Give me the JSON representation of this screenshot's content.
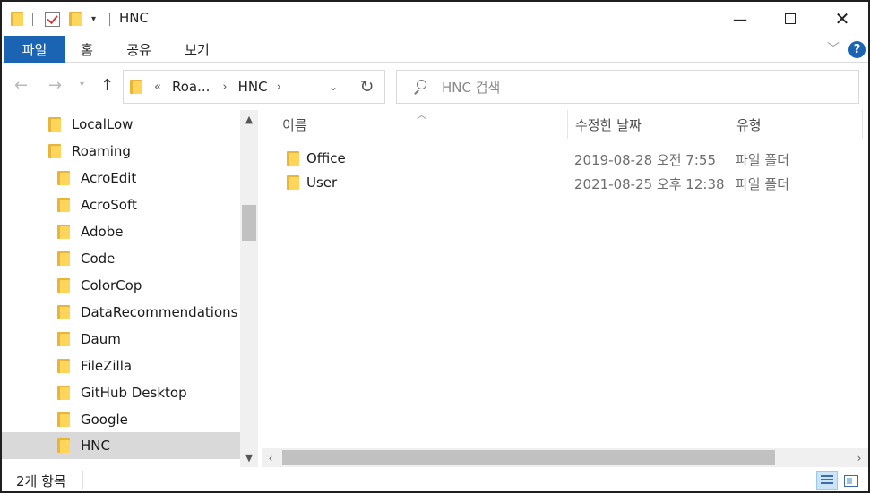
{
  "window": {
    "title": "HNC"
  },
  "ribbon": {
    "tabs": [
      {
        "label": "파일"
      },
      {
        "label": "홈"
      },
      {
        "label": "공유"
      },
      {
        "label": "보기"
      }
    ]
  },
  "address": {
    "overflow": "«",
    "crumb1": "Roa...",
    "crumb2": "HNC"
  },
  "search": {
    "placeholder": "HNC 검색"
  },
  "navpane": {
    "items": [
      {
        "label": "LocalLow"
      },
      {
        "label": "Roaming"
      },
      {
        "label": "AcroEdit"
      },
      {
        "label": "AcroSoft"
      },
      {
        "label": "Adobe"
      },
      {
        "label": "Code"
      },
      {
        "label": "ColorCop"
      },
      {
        "label": "DataRecommendations"
      },
      {
        "label": "Daum"
      },
      {
        "label": "FileZilla"
      },
      {
        "label": "GitHub Desktop"
      },
      {
        "label": "Google"
      },
      {
        "label": "HNC"
      }
    ],
    "selected": "HNC"
  },
  "filelist": {
    "columns": {
      "name": "이름",
      "date": "수정한 날짜",
      "type": "유형"
    },
    "rows": [
      {
        "name": "Office",
        "date": "2019-08-28 오전 7:55",
        "type": "파일 폴더"
      },
      {
        "name": "User",
        "date": "2021-08-25 오후 12:38",
        "type": "파일 폴더"
      }
    ]
  },
  "status": {
    "count": "2개 항목"
  },
  "colors": {
    "accent": "#1a64b3",
    "selection": "#d9d9d9",
    "folder": "#ffd65a"
  }
}
